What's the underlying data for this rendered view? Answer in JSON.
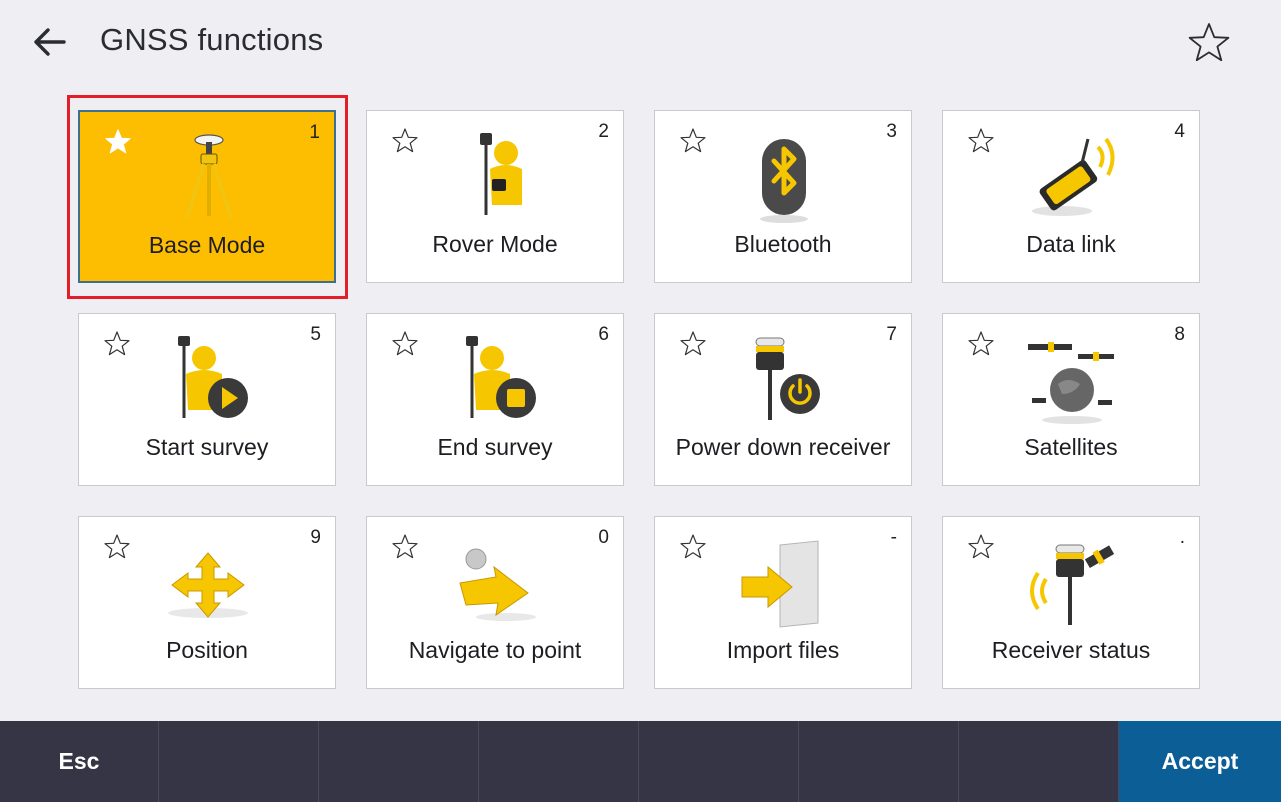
{
  "header": {
    "title": "GNSS functions"
  },
  "tiles": [
    {
      "label": "Base Mode",
      "shortcut": "1",
      "icon": "base-tripod-icon",
      "selected": true
    },
    {
      "label": "Rover Mode",
      "shortcut": "2",
      "icon": "rover-person-icon"
    },
    {
      "label": "Bluetooth",
      "shortcut": "3",
      "icon": "bluetooth-icon"
    },
    {
      "label": "Data link",
      "shortcut": "4",
      "icon": "radio-data-link-icon"
    },
    {
      "label": "Start survey",
      "shortcut": "5",
      "icon": "start-survey-icon"
    },
    {
      "label": "End survey",
      "shortcut": "6",
      "icon": "end-survey-icon"
    },
    {
      "label": "Power down receiver",
      "shortcut": "7",
      "icon": "receiver-power-icon"
    },
    {
      "label": "Satellites",
      "shortcut": "8",
      "icon": "satellites-icon"
    },
    {
      "label": "Position",
      "shortcut": "9",
      "icon": "position-arrows-icon"
    },
    {
      "label": "Navigate to point",
      "shortcut": "0",
      "icon": "navigate-arrow-icon"
    },
    {
      "label": "Import files",
      "shortcut": "-",
      "icon": "import-files-icon"
    },
    {
      "label": "Receiver status",
      "shortcut": ".",
      "icon": "receiver-status-icon"
    }
  ],
  "footer": {
    "esc_label": "Esc",
    "accept_label": "Accept"
  },
  "colors": {
    "selected_tile": "#fdbd00",
    "highlight": "#e41e26",
    "footer_bg": "#363545",
    "accept_bg": "#0b5f96"
  }
}
